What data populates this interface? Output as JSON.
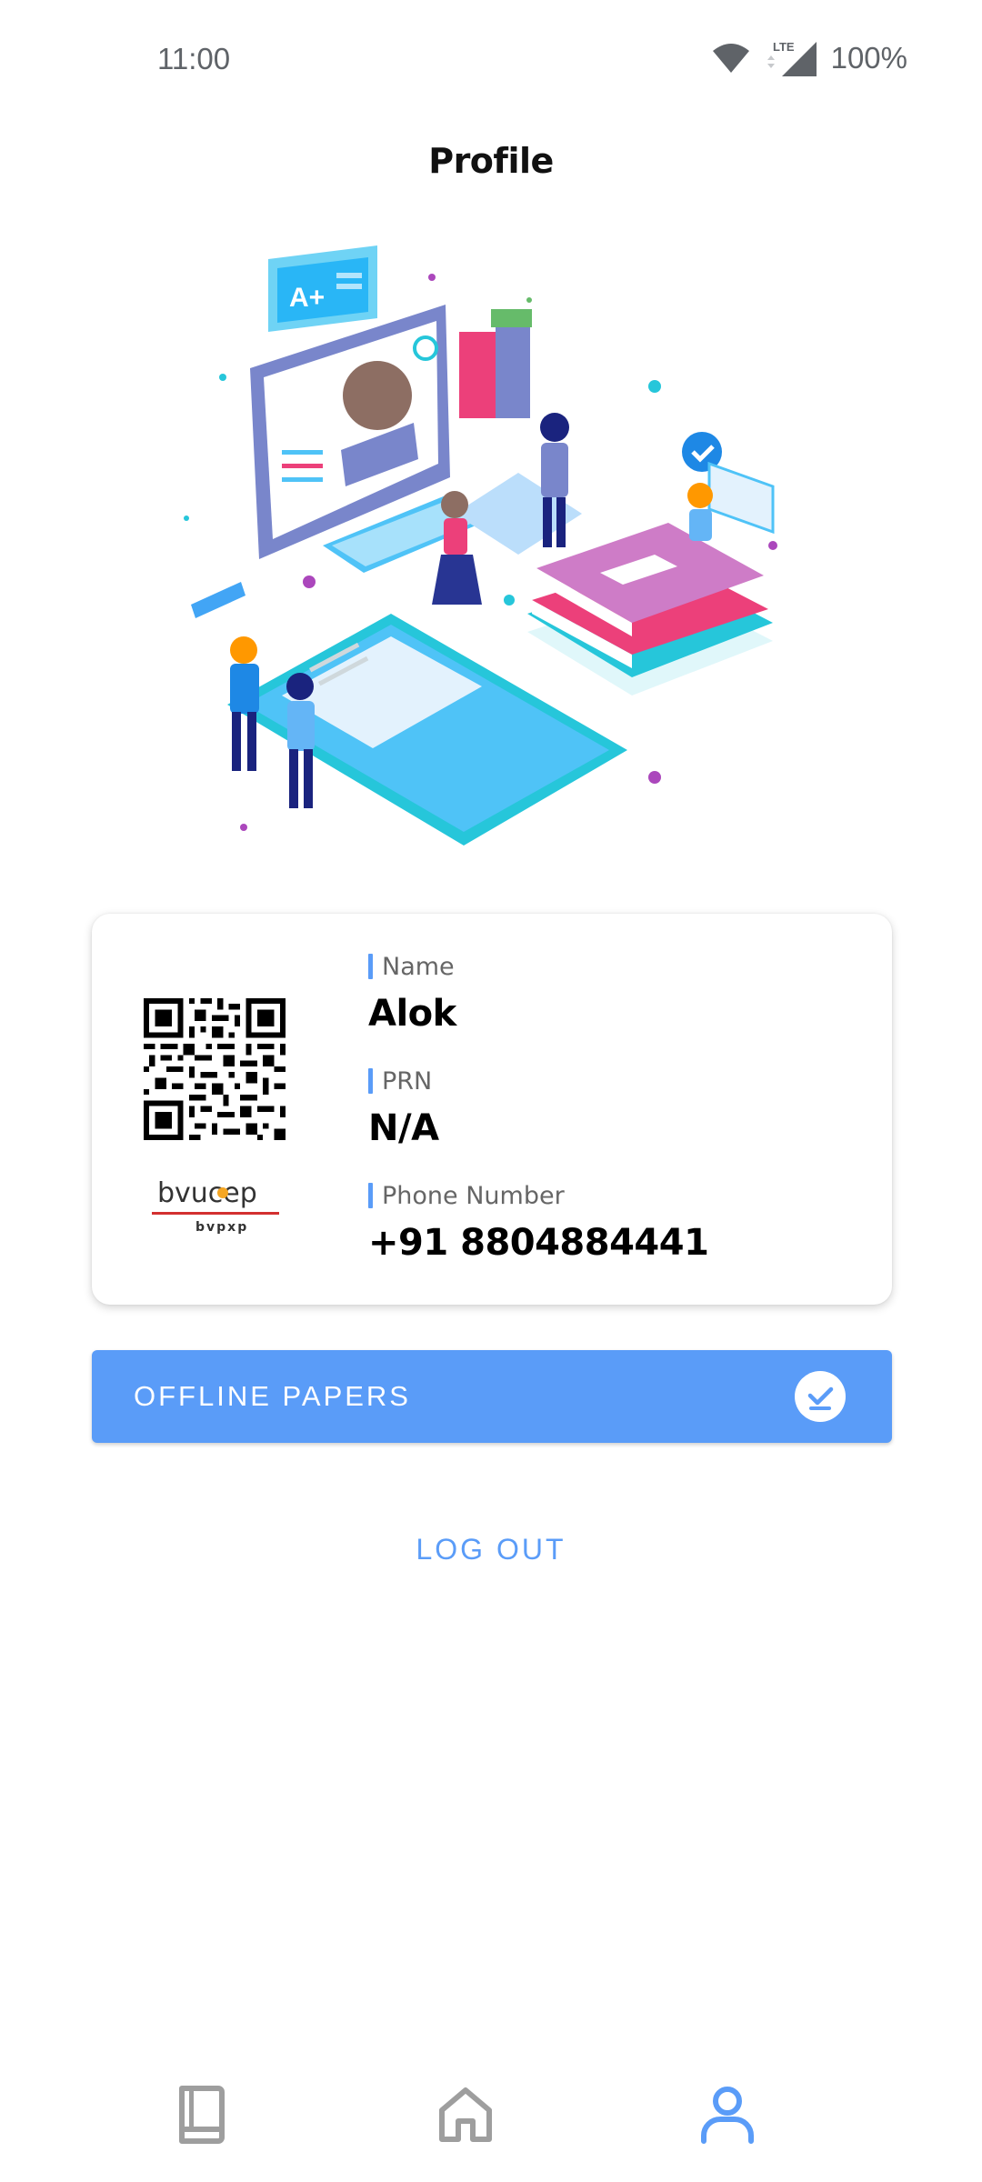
{
  "status_bar": {
    "time": "11:00",
    "network": "LTE",
    "battery": "100%"
  },
  "header": {
    "title": "Profile"
  },
  "profile": {
    "fields": [
      {
        "label": "Name",
        "value": "Alok"
      },
      {
        "label": "PRN",
        "value": "N/A"
      },
      {
        "label": "Phone Number",
        "value": "+91 8804884441"
      }
    ],
    "logo_text": "bvucep",
    "logo_subtext": "bvpxp"
  },
  "actions": {
    "offline_papers_label": "OFFLINE PAPERS",
    "logout_label": "LOG OUT"
  },
  "bottom_nav": {
    "items": [
      {
        "icon": "book-icon",
        "active": false
      },
      {
        "icon": "home-icon",
        "active": false
      },
      {
        "icon": "person-icon",
        "active": true
      }
    ]
  },
  "colors": {
    "accent": "#5a9cf8",
    "inactive_icon": "#9e9e9e"
  }
}
